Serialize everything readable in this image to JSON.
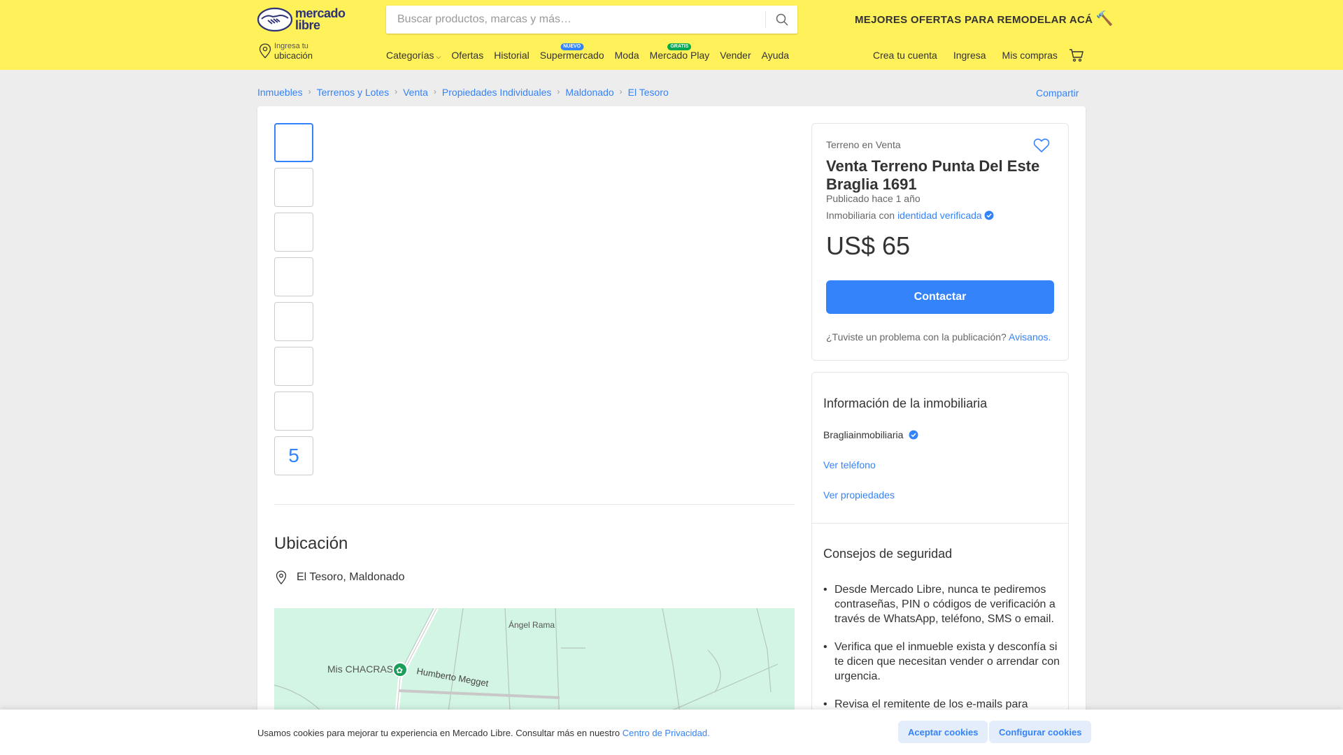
{
  "header": {
    "logo_line1": "mercado",
    "logo_line2": "libre",
    "search_placeholder": "Buscar productos, marcas y más…",
    "promo": "MEJORES OFERTAS PARA REMODELAR ACÁ",
    "location_line1": "Ingresa tu",
    "location_line2": "ubicación",
    "nav": [
      {
        "label": "Categorías",
        "badge": ""
      },
      {
        "label": "Ofertas",
        "badge": ""
      },
      {
        "label": "Historial",
        "badge": ""
      },
      {
        "label": "Supermercado",
        "badge": "NUEVO"
      },
      {
        "label": "Moda",
        "badge": ""
      },
      {
        "label": "Mercado Play",
        "badge": "GRATIS"
      },
      {
        "label": "Vender",
        "badge": ""
      },
      {
        "label": "Ayuda",
        "badge": ""
      }
    ],
    "user_nav": [
      "Crea tu cuenta",
      "Ingresa",
      "Mis compras"
    ],
    "brand_color": "#fff159",
    "accent_color": "#3483fa"
  },
  "breadcrumb": [
    "Inmuebles",
    "Terrenos y Lotes",
    "Venta",
    "Propiedades Individuales",
    "Maldonado",
    "El Tesoro"
  ],
  "share_label": "Compartir",
  "gallery": {
    "more_count": "5"
  },
  "location": {
    "title": "Ubicación",
    "address": "El Tesoro, Maldonado",
    "map_labels": {
      "street1": "Ángel Rama",
      "place": "Mis CHACRAS",
      "street2": "Humberto Megget"
    }
  },
  "listing": {
    "condition": "Terreno en Venta",
    "title": "Venta Terreno Punta Del Este Braglia 1691",
    "published": "Publicado hace 1 año",
    "inmo_prefix": "Inmobiliaria con",
    "inmo_link": "identidad verificada",
    "price": "US$ 65",
    "contact_button": "Contactar",
    "report_text": "¿Tuviste un problema con la publicación?",
    "report_link": "Avisanos."
  },
  "seller": {
    "title": "Información de la inmobiliaria",
    "name": "Bragliainmobiliaria",
    "phone_link": "Ver teléfono",
    "properties_link": "Ver propiedades"
  },
  "safety": {
    "title": "Consejos de seguridad",
    "tips": [
      "Desde Mercado Libre, nunca te pediremos contraseñas, PIN o códigos de verificación a través de WhatsApp, teléfono, SMS o email.",
      "Verifica que el inmueble exista y desconfía si te dicen que necesitan vender o arrendar con urgencia.",
      "Revisa el remitente de los e-mails para"
    ]
  },
  "cookies": {
    "text": "Usamos cookies para mejorar tu experiencia en Mercado Libre. Consultar más en nuestro",
    "link": "Centro de Privacidad.",
    "accept": "Aceptar cookies",
    "configure": "Configurar cookies"
  }
}
